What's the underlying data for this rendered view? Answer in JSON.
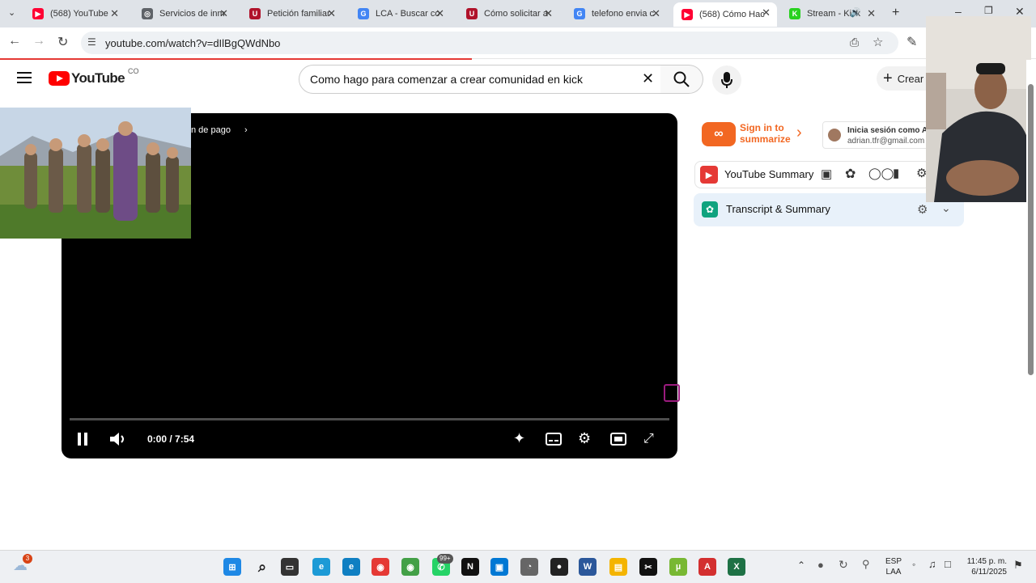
{
  "browser": {
    "tabs": [
      {
        "title": "(568) YouTube",
        "fav": "youtube-icon",
        "color": "#ff0033"
      },
      {
        "title": "Servicios de inm",
        "fav": "globe-icon",
        "color": "#5f6368"
      },
      {
        "title": "Petición familiar",
        "fav": "uscis-icon",
        "color": "#b0122a"
      },
      {
        "title": "LCA - Buscar co",
        "fav": "google-icon",
        "color": "#4285f4"
      },
      {
        "title": "Cómo solicitar a",
        "fav": "uscis-icon",
        "color": "#b0122a"
      },
      {
        "title": "telefono envia c",
        "fav": "google-icon",
        "color": "#4285f4"
      },
      {
        "title": "(568) Cómo Hac",
        "fav": "youtube-icon",
        "color": "#ff0033"
      },
      {
        "title": "Stream - Kick",
        "fav": "kick-icon",
        "color": "#28d11f"
      }
    ],
    "url": "youtube.com/watch?v=dIlBgQWdNbo"
  },
  "youtube": {
    "country": "CO",
    "logo": "YouTube",
    "search_query": "Como hago para comenzar a crear comunidad en kick",
    "create_label": "Crear"
  },
  "player": {
    "overlay_text": "n de pago",
    "time": "0:00 / 7:54"
  },
  "sidebar": {
    "signin_summarize": "Sign in to summarize",
    "account_line1": "Inicia sesión como A",
    "account_email": "adrian.tfr@gmail.com",
    "yt_summary_label": "YouTube Summary",
    "transcript_label": "Transcript & Summary"
  },
  "taskbar": {
    "weather_badge": "3",
    "whatsapp_badge": "99+",
    "lang_line1": "ESP",
    "lang_line2": "LAA",
    "clock_time": "11:45 p. m.",
    "clock_date": "6/11/2025"
  }
}
